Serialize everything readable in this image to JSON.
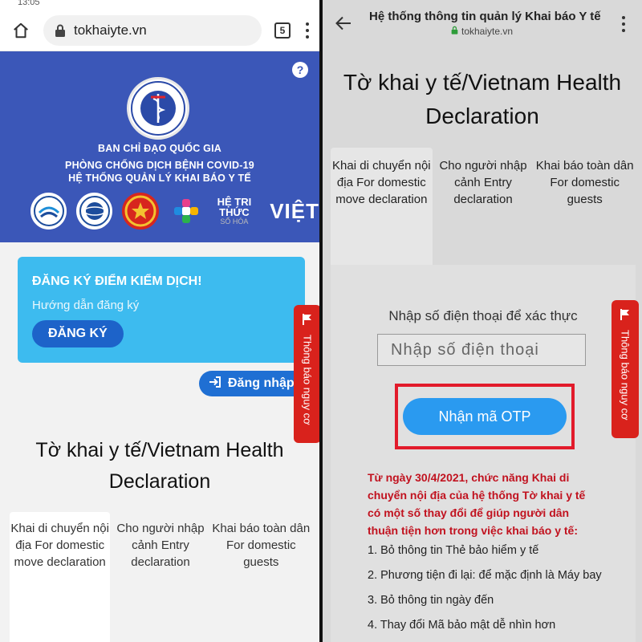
{
  "left": {
    "status": {
      "time": "13:05"
    },
    "browser": {
      "url": "tokhaiyte.vn",
      "tab_count": "5"
    },
    "banner": {
      "help": "?",
      "seal_text_top": "BỘ Y TẾ",
      "seal_text_bottom": "MINISTRY OF HEALTH",
      "line1": "BAN CHỈ ĐẠO QUỐC GIA",
      "line2": "PHÒNG CHỐNG DỊCH BỆNH COVID-19",
      "line3": "HỆ THỐNG QUẢN LÝ KHAI BÁO Y TẾ",
      "brand_small": "HỆ TRI THỨC",
      "brand_sub": "SỐ HÓA",
      "brand_big": "VIỆT"
    },
    "register": {
      "title": "ĐĂNG KÝ ĐIỂM KIỂM DỊCH!",
      "subtitle": "Hướng dẫn đăng ký",
      "button": "ĐĂNG KÝ"
    },
    "login_button": "Đăng nhập",
    "side_tab": "Thông báo nguy cơ",
    "page_title": "Tờ khai y tế/Vietnam Health Declaration",
    "tabs": [
      {
        "label": "Khai di chuyển nội địa For domestic move declaration"
      },
      {
        "label": "Cho người nhập cảnh Entry declaration"
      },
      {
        "label": "Khai báo toàn dân For domestic guests"
      }
    ]
  },
  "right": {
    "header": {
      "title": "Hệ thống thông tin quản lý Khai báo Y tế",
      "url": "tokhaiyte.vn"
    },
    "page_title": "Tờ khai y tế/Vietnam Health Declaration",
    "tabs": [
      {
        "label": "Khai di chuyển nội địa For domestic move declaration"
      },
      {
        "label": "Cho người nhập cảnh Entry declaration"
      },
      {
        "label": "Khai báo toàn dân For domestic guests"
      }
    ],
    "phone_label": "Nhập số điện thoại để xác thực",
    "phone_placeholder": "Nhập số điện thoại",
    "otp_button": "Nhận mã OTP",
    "side_tab": "Thông báo nguy cơ",
    "notice": "Từ ngày 30/4/2021, chức năng Khai di chuyển nội địa của hệ thống Tờ khai y tế có một số thay đổi để giúp người dân thuận tiện hơn trong việc khai báo y tế:",
    "notice_items": [
      "1. Bỏ thông tin Thẻ bảo hiểm y tế",
      "2. Phương tiện đi lại: để mặc định là Máy bay",
      "3. Bỏ thông tin ngày đến",
      "4. Thay đổi Mã bảo mật dễ nhìn hơn"
    ]
  },
  "colors": {
    "banner_blue": "#3b57b8",
    "register_card": "#3dbbef",
    "register_button": "#1d63c9",
    "login_button": "#1f6fd3",
    "side_tab_red": "#d9221c",
    "otp_button": "#2a9af0",
    "notice_red": "#c1121f",
    "highlight_frame": "#e21b2b"
  },
  "icons": {
    "home": "home-icon",
    "lock": "lock-icon",
    "menu": "kebab-menu-icon",
    "help": "help-icon",
    "login": "login-icon",
    "alert": "alert-flag-icon",
    "back": "back-arrow-icon"
  }
}
